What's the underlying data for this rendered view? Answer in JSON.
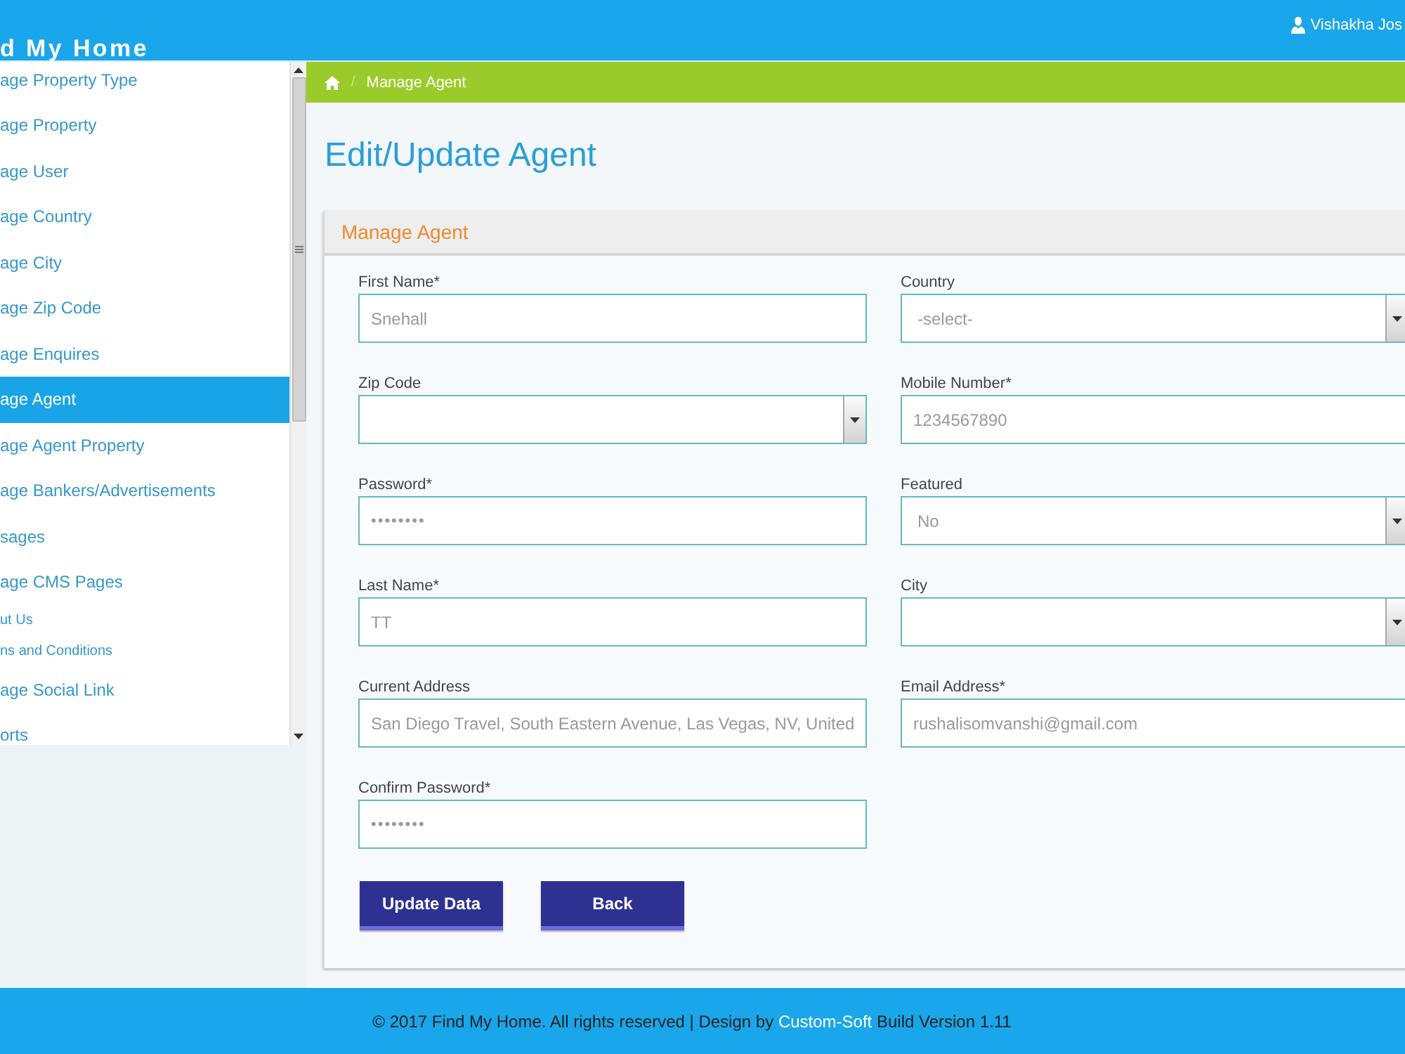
{
  "header": {
    "brand": "d My Home",
    "user": "Vishakha Jos"
  },
  "sidebar": {
    "items": [
      {
        "label": "age Property Type",
        "selected": false
      },
      {
        "label": "age Property",
        "selected": false
      },
      {
        "label": "age User",
        "selected": false
      },
      {
        "label": "age Country",
        "selected": false
      },
      {
        "label": "age City",
        "selected": false
      },
      {
        "label": "age Zip Code",
        "selected": false
      },
      {
        "label": "age Enquires",
        "selected": false
      },
      {
        "label": "age Agent",
        "selected": true
      },
      {
        "label": "age Agent Property",
        "selected": false
      },
      {
        "label": "age Bankers/Advertisements",
        "selected": false
      },
      {
        "label": "sages",
        "selected": false
      },
      {
        "label": "age CMS Pages",
        "selected": false,
        "children": [
          {
            "label": "ut Us",
            "selected": false
          },
          {
            "label": "ns and Conditions",
            "selected": false
          }
        ]
      },
      {
        "label": "age Social Link",
        "selected": false
      },
      {
        "label": "orts",
        "selected": false
      }
    ]
  },
  "breadcrumb": {
    "separator": "/",
    "items": [
      "Manage Agent"
    ]
  },
  "page_title": "Edit/Update Agent",
  "panel": {
    "title": "Manage Agent",
    "fields": [
      {
        "kind": "text",
        "label": "First Name*",
        "value": "Snehall"
      },
      {
        "kind": "select",
        "label": "Country",
        "value": "-select-"
      },
      {
        "kind": "select",
        "label": "Zip Code"
      },
      {
        "kind": "text",
        "label": "Mobile Number*",
        "value": "1234567890"
      },
      {
        "kind": "password",
        "label": "Password*",
        "value": "••••••••"
      },
      {
        "kind": "select",
        "label": "Featured",
        "value": "No"
      },
      {
        "kind": "text",
        "label": "Last Name*",
        "value": "TT"
      },
      {
        "kind": "select",
        "label": "City"
      },
      {
        "kind": "text",
        "label": "Current Address",
        "value": "San Diego Travel, South Eastern Avenue, Las Vegas, NV, United"
      },
      {
        "kind": "text",
        "label": "Email Address*",
        "value": "rushalisomvanshi@gmail.com"
      },
      {
        "kind": "password",
        "label": "Confirm Password*",
        "value": "••••••••"
      }
    ],
    "buttons": [
      {
        "label": "Update Data"
      },
      {
        "label": "Back"
      }
    ]
  },
  "footer": {
    "text": "© 2017 Find My Home. All rights reserved | Design by",
    "link": "Custom-Soft",
    "version": "Build Version 1.11"
  }
}
